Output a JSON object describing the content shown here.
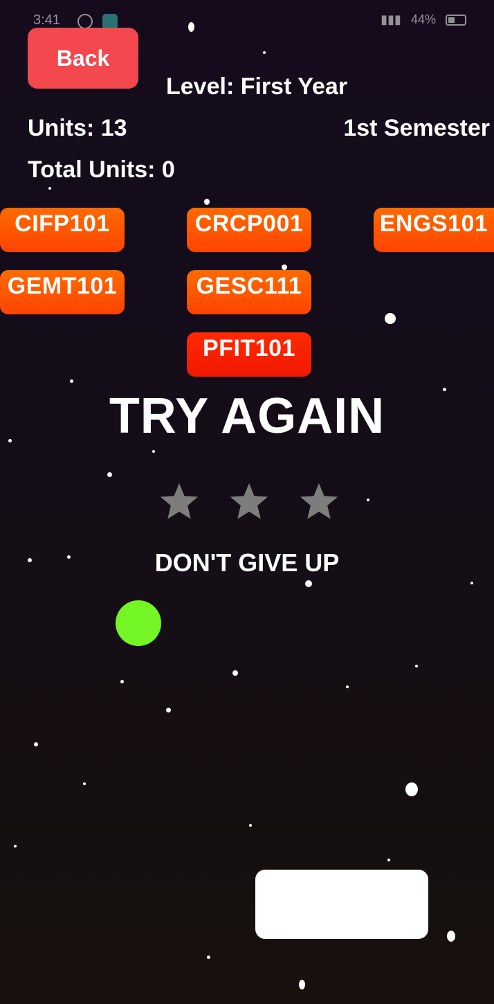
{
  "status_bar": {
    "time": "3:41",
    "battery": "44%"
  },
  "header": {
    "back_label": "Back",
    "level": "Level: First Year",
    "units": "Units: 13",
    "semester": "1st Semester",
    "total_units": "Total Units: 0"
  },
  "courses": [
    "CIFP101",
    "CRCP001",
    "ENGS101",
    "GEMT101",
    "GESC111",
    "PFIT101"
  ],
  "result": {
    "title": "TRY AGAIN",
    "stars_earned": 0,
    "stars_total": 3,
    "message": "DON'T GIVE UP"
  },
  "colors": {
    "back_button": "#f3484e",
    "course_button": "#ff5a00",
    "course_button_active": "#ff2200",
    "ball": "#73f526",
    "star_empty": "#7d7d7d",
    "paddle": "#ffffff"
  }
}
